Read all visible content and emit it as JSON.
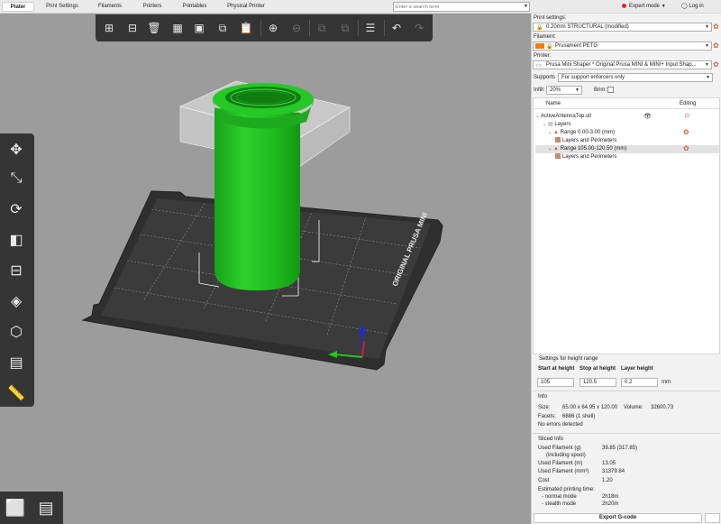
{
  "tabs": [
    "Plater",
    "Print Settings",
    "Filaments",
    "Printers",
    "Printables",
    "Physical Printer"
  ],
  "search": {
    "placeholder": "Enter a search term"
  },
  "mode": {
    "label": "Expert mode",
    "login": "Log in"
  },
  "toolbar_icons": [
    "add-icon",
    "delete-icon",
    "delete-all-icon",
    "arrange-icon",
    "arrange-selection-icon",
    "copy-icon",
    "paste-icon",
    "add-instance-icon",
    "remove-instance-icon",
    "split-objects-icon",
    "split-parts-icon",
    "layers-editing-icon",
    "undo-icon",
    "redo-icon"
  ],
  "left_tools": [
    "move-icon",
    "scale-icon",
    "rotate-icon",
    "place-on-face-icon",
    "cut-icon",
    "paint-supports-icon",
    "seam-painting-icon",
    "mmu-painting-icon",
    "measure-icon"
  ],
  "print_settings": {
    "label": "Print settings:",
    "value": "0.20mm STRUCTURAL (modified)"
  },
  "filament": {
    "label": "Filament:",
    "value": "Prusament PETG",
    "color": "#f27c14"
  },
  "printer": {
    "label": "Printer:",
    "value": "Prusa Mini Shaper * Original Prusa MINI & MINI+ Input Shap..."
  },
  "supports": {
    "label": "Supports",
    "value": "For support enforcers only"
  },
  "infill": {
    "label": "Infill:",
    "value": "20%"
  },
  "brim": {
    "label": "Brim:"
  },
  "tree": {
    "col_name": "Name",
    "col_editing": "Editing",
    "rows": [
      {
        "label": "ActiveAntennaTop.stl"
      },
      {
        "label": "Layers"
      },
      {
        "label": "Range 0.00-3.00 (mm)"
      },
      {
        "label": "Layers and Perimeters"
      },
      {
        "label": "Range 105.00-120.50 (mm)"
      },
      {
        "label": "Layers and Perimeters"
      }
    ]
  },
  "height_range": {
    "title": "Settings for height range",
    "start_label": "Start at height",
    "stop_label": "Stop at height",
    "layer_label": "Layer height",
    "start": "105",
    "stop": "120.5",
    "layer": "0.2",
    "unit": "mm"
  },
  "info": {
    "title": "Info",
    "size_label": "Size:",
    "size": "65.00 x 64.95 x 120.00",
    "volume_label": "Volume:",
    "volume": "32600.73",
    "facets_label": "Facets:",
    "facets": "6886 (1 shell)",
    "errors": "No errors detected"
  },
  "sliced": {
    "title": "Sliced Info",
    "used_g_label": "Used Filament (g)",
    "used_g_sub": "(including spool)",
    "used_g": "39.85 (317.85)",
    "used_m_label": "Used Filament (m)",
    "used_m": "13.05",
    "used_mm3_label": "Used Filament (mm³)",
    "used_mm3": "31379.84",
    "cost_label": "Cost",
    "cost": "1.20",
    "est_label": "Estimated printing time:",
    "normal_label": "- normal mode",
    "normal": "2h18m",
    "stealth_label": "- stealth mode",
    "stealth": "2h20m"
  },
  "bed_text": "ORIGINAL PRUSA MINI",
  "export_label": "Export G-code",
  "colors": {
    "model": "#1fb91f",
    "bed": "#2e2e2e",
    "viewport": "#9c9c9c",
    "accent": "#c8643c"
  }
}
